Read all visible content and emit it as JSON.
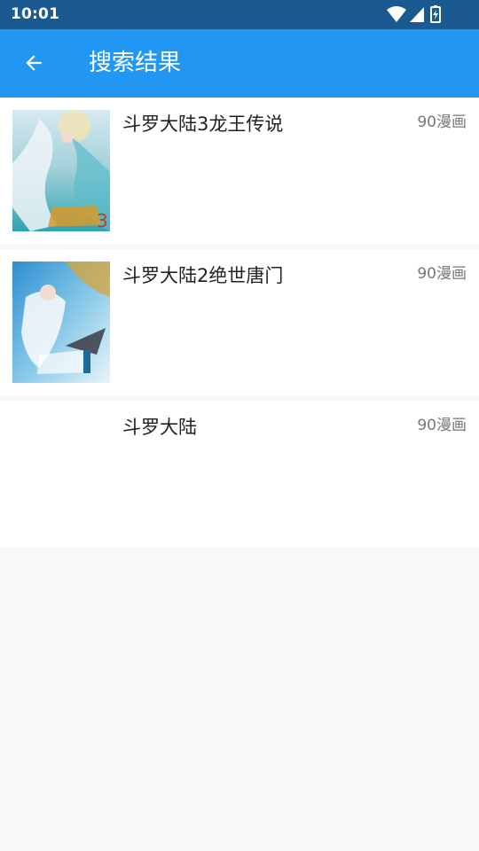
{
  "status_bar": {
    "time": "10:01",
    "icons": [
      "wifi-icon",
      "signal-icon",
      "battery-charging-icon"
    ]
  },
  "app_bar": {
    "back_icon": "arrow-back-icon",
    "title": "搜索结果",
    "color": "#2196f3"
  },
  "results": [
    {
      "title": "斗罗大陆3龙王传说",
      "source": "90漫画",
      "cover": "cover-dragon-king"
    },
    {
      "title": "斗罗大陆2绝世唐门",
      "source": "90漫画",
      "cover": "cover-tang-sect"
    },
    {
      "title": "斗罗大陆",
      "source": "90漫画",
      "cover": ""
    }
  ]
}
